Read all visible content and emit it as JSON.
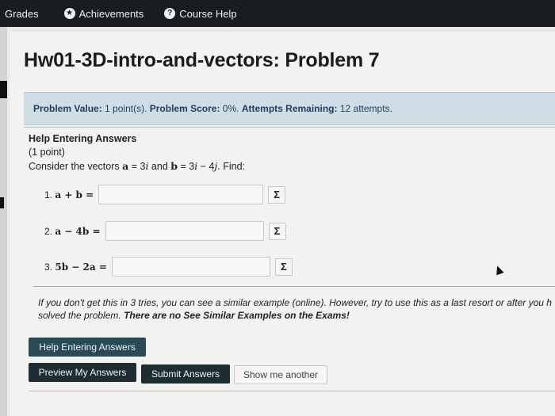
{
  "nav": {
    "grades": "Grades",
    "achievements": "Achievements",
    "achievements_icon": "star-badge-icon",
    "course_help": "Course Help",
    "course_help_icon": "question-icon"
  },
  "page": {
    "title": "Hw01-3D-intro-and-vectors: Problem 7"
  },
  "status": {
    "value_label": "Problem Value:",
    "value": "1 point(s).",
    "score_label": "Problem Score:",
    "score": "0%.",
    "attempts_label": "Attempts Remaining:",
    "attempts": "12 attempts."
  },
  "problem": {
    "help_title": "Help Entering Answers",
    "points": "(1 point)",
    "prompt_start": "Consider the vectors",
    "vec_a": "a",
    "eq1": " = 3",
    "i": "i",
    "and": " and ",
    "vec_b": "b",
    "eq2": " = 3",
    "i2": "i",
    "minus": " − 4",
    "j": "j",
    "find": ". Find:"
  },
  "answers": [
    {
      "num": "1.",
      "expr": "a + b =",
      "value": ""
    },
    {
      "num": "2.",
      "expr": "a − 4b =",
      "value": ""
    },
    {
      "num": "3.",
      "expr": "5b − 2a =",
      "value": ""
    }
  ],
  "sigma_icon": "sigma-icon",
  "sigma": "Σ",
  "note": {
    "text": "If you don't get this in 3 tries, you can see a similar example (online). However, try to use this as a last resort or after you h",
    "bold": "There are no See Similar Examples on the Exams!",
    "prefix": "solved the problem. "
  },
  "buttons": {
    "help": "Help Entering Answers",
    "preview": "Preview My Answers",
    "submit": "Submit Answers",
    "another": "Show me another"
  },
  "colors": {
    "topbar": "#1a1d20",
    "info_box": "#cfdde6",
    "button_dark": "#1e2d33"
  }
}
